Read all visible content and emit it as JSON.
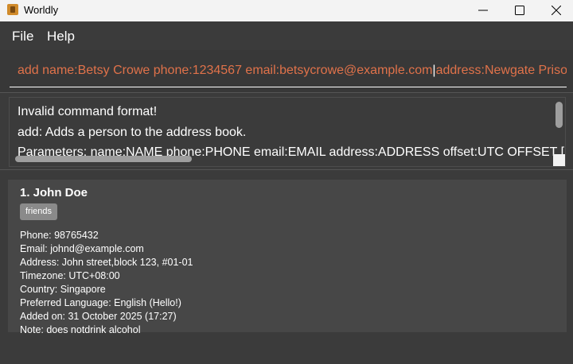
{
  "window": {
    "title": "Worldly",
    "icon": "app-icon"
  },
  "menu": {
    "file": "File",
    "help": "Help"
  },
  "command": {
    "value_before_caret": "add name:Betsy Crowe phone:1234567 email:betsycrowe@example.com",
    "value_after_caret": "address:Newgate Prison",
    "text_color": "#e0724a"
  },
  "result": {
    "line1": "Invalid command format!",
    "line2": "add: Adds a person to the address book.",
    "line3": "Parameters: name:NAME phone:PHONE email:EMAIL address:ADDRESS offset:UTC OFFSET [..."
  },
  "persons": [
    {
      "index_name": "1. John Doe",
      "tag": "friends",
      "phone": "Phone: 98765432",
      "email": "Email: johnd@example.com",
      "address": "Address: John street,block 123, #01-01",
      "timezone": "Timezone: UTC+08:00",
      "country": "Country: Singapore",
      "language": "Preferred Language: English (Hello!)",
      "added": "Added on: 31 October 2025 (17:27)",
      "note": "Note: does notdrink alcohol"
    }
  ]
}
